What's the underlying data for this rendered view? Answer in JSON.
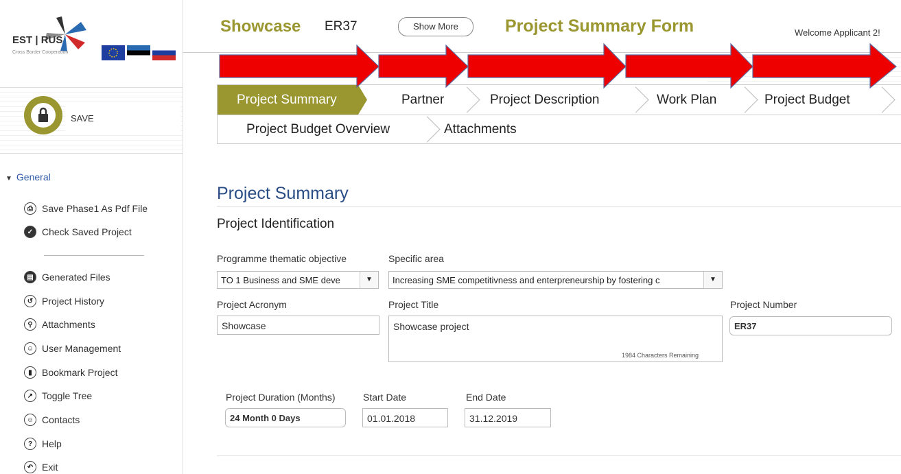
{
  "sidebar": {
    "logo_text": "EST | RUS",
    "logo_sub": "Cross Border Cooperation",
    "save_label": "SAVE",
    "general_label": "General",
    "items": [
      {
        "label": "Save Phase1 As Pdf File",
        "icon": "printer-icon"
      },
      {
        "label": "Check Saved Project",
        "icon": "check-icon"
      },
      {
        "label": "Generated Files",
        "icon": "files-icon"
      },
      {
        "label": "Project History",
        "icon": "history-icon"
      },
      {
        "label": "Attachments",
        "icon": "paperclip-icon"
      },
      {
        "label": "User Management",
        "icon": "user-icon"
      },
      {
        "label": "Bookmark Project",
        "icon": "bookmark-icon"
      },
      {
        "label": "Toggle Tree",
        "icon": "external-icon"
      },
      {
        "label": "Contacts",
        "icon": "contact-icon"
      },
      {
        "label": "Help",
        "icon": "help-icon"
      },
      {
        "label": "Exit",
        "icon": "exit-icon"
      }
    ]
  },
  "header": {
    "project_label": "Showcase",
    "project_code": "ER37",
    "show_more": "Show More",
    "form_title": "Project Summary Form",
    "welcome": "Welcome Applicant 2!"
  },
  "tabs": {
    "row1": [
      "Project Summary",
      "Partner",
      "Project Description",
      "Work Plan",
      "Project Budget"
    ],
    "row2": [
      "Project Budget Overview",
      "Attachments"
    ],
    "active": "Project Summary"
  },
  "content": {
    "section_title": "Project Summary",
    "subsection_title": "Project Identification",
    "thematic_label": "Programme thematic objective",
    "thematic_value": "TO 1 Business and SME deve",
    "area_label": "Specific area",
    "area_value": "Increasing SME competitivness and enterpreneurship by fostering c",
    "acronym_label": "Project Acronym",
    "acronym_value": "Showcase",
    "title_label": "Project Title",
    "title_value": "Showcase project",
    "chars_remaining": "1984 Characters Remaining",
    "number_label": "Project Number",
    "number_value": "ER37",
    "duration_label": "Project Duration (Months)",
    "duration_value": "24 Month 0 Days",
    "start_label": "Start Date",
    "start_value": "01.01.2018",
    "end_label": "End Date",
    "end_value": "31.12.2019"
  },
  "colors": {
    "accent": "#9a9630",
    "heading_blue": "#2a4d86",
    "arrow_red": "#ee0000"
  }
}
